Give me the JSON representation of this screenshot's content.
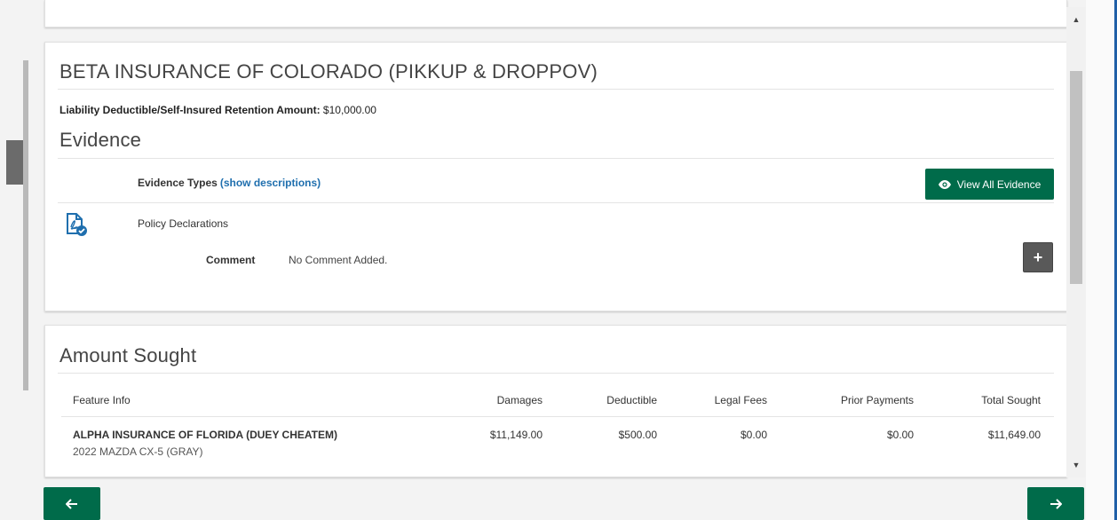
{
  "policy": {
    "title": "BETA INSURANCE OF COLORADO (PIKKUP & DROPPOV)",
    "deductible_label": "Liability Deductible/Self-Insured Retention Amount:",
    "deductible_value": "$10,000.00"
  },
  "evidence": {
    "heading": "Evidence",
    "types_label": "Evidence Types",
    "show_descriptions": "(show descriptions)",
    "view_all_label": "View All Evidence",
    "items": [
      {
        "name": "Policy Declarations",
        "icon": "pdf-check-icon",
        "comment_label": "Comment",
        "comment_value": "No Comment Added."
      }
    ]
  },
  "amount_sought": {
    "heading": "Amount Sought",
    "columns": [
      "Feature Info",
      "Damages",
      "Deductible",
      "Legal Fees",
      "Prior Payments",
      "Total Sought"
    ],
    "rows": [
      {
        "feature": "ALPHA INSURANCE OF FLORIDA (DUEY CHEATEM)",
        "vehicle": "2022 MAZDA CX-5 (GRAY)",
        "damages": "$11,149.00",
        "deductible": "$500.00",
        "legal_fees": "$0.00",
        "prior_payments": "$0.00",
        "total_sought": "$11,649.00"
      }
    ]
  },
  "colors": {
    "primary_green": "#006b4a",
    "link_blue": "#1f6fae",
    "accent_blue": "#1f5fa7"
  },
  "nav": {
    "back_icon": "arrow-left-icon",
    "next_icon": "arrow-right-icon"
  }
}
